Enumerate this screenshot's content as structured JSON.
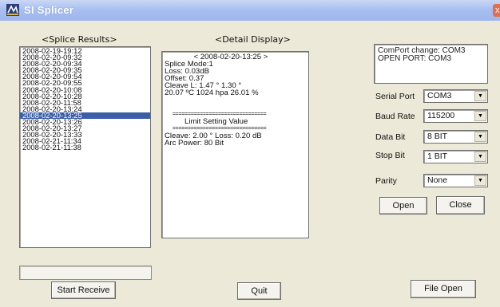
{
  "window": {
    "title": "SI Splicer",
    "close_glyph": "x"
  },
  "splice_results": {
    "heading": "<Splice Results>",
    "items": [
      "2008-02-19-19:12",
      "2008-02-20-09:32",
      "2008-02-20-09:34",
      "2008-02-20-09:35",
      "2008-02-20-09:54",
      "2008-02-20-09:55",
      "2008-02-20-10:08",
      "2008-02-20-10:28",
      "2008-02-20-11:58",
      "2008-02-20-13:24",
      "2008-02-20-13:25",
      "2008-02-20-13:26",
      "2008-02-20-13:27",
      "2008-02-20-13:33",
      "2008-02-21-11:34",
      "2008-02-21-11:38"
    ],
    "selected_index": 10
  },
  "detail_display": {
    "heading": "<Detail Display>",
    "lines": {
      "date": "< 2008-02-20-13:25 >",
      "mode": "Splice Mode:1",
      "loss": "Loss: 0.03dB",
      "offset": "Offset: 0.37",
      "cleave": "Cleave L: 1.47 °  1.30 °",
      "env": "20.07 ºC   1024  hpa   26.01 %",
      "sep1": "===============================",
      "limit_title": "Limit Setting Value",
      "sep2": "===============================",
      "limit_values": "Cleave: 2.00 °    Loss: 0.20 dB",
      "arc_power": "Arc Power: 80 Bit"
    }
  },
  "status_box": {
    "line1": "ComPort change: COM3",
    "line2": "OPEN PORT: COM3"
  },
  "serial": {
    "serial_port_label": "Serial Port",
    "serial_port_value": "COM3",
    "baud_rate_label": "Baud Rate",
    "baud_rate_value": "115200",
    "data_bit_label": "Data Bit",
    "data_bit_value": "8 BIT",
    "stop_bit_label": "Stop Bit",
    "stop_bit_value": "1 BIT",
    "parity_label": "Parity",
    "parity_value": "None",
    "dropdown_glyph": "▼"
  },
  "buttons": {
    "open": "Open",
    "close": "Close",
    "start_receive": "Start Receive",
    "quit": "Quit",
    "file_open": "File Open"
  },
  "progress": {
    "fraction": 0.0
  }
}
